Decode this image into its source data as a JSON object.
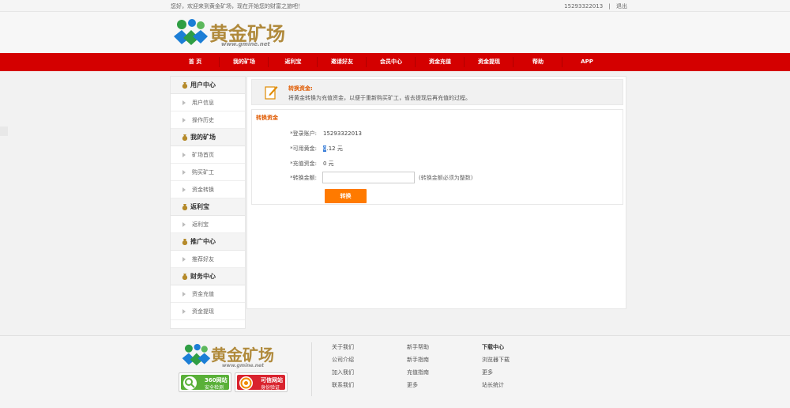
{
  "topbar": {
    "welcome": "您好，欢迎来到黄金矿场，现在开始您的财富之旅吧！",
    "account": "15293322013",
    "logout": "退出"
  },
  "brand": {
    "name": "黄金矿场",
    "url": "www.gmine.net"
  },
  "nav": {
    "items": [
      "首 页",
      "我的矿场",
      "返利宝",
      "邀请好友",
      "会员中心",
      "资金充值",
      "资金提现",
      "帮助",
      "APP"
    ]
  },
  "sidebar": {
    "groups": [
      {
        "title": "用户中心",
        "items": [
          "用户信息",
          "操作历史"
        ]
      },
      {
        "title": "我的矿场",
        "items": [
          "矿场首页",
          "购买矿工",
          "资金转换"
        ]
      },
      {
        "title": "返利宝",
        "items": [
          "返利宝"
        ]
      },
      {
        "title": "推广中心",
        "items": [
          "推荐好友"
        ]
      },
      {
        "title": "财务中心",
        "items": [
          "资金充值",
          "资金提现"
        ]
      }
    ]
  },
  "notice": {
    "title": "转换资金:",
    "text": "将黄金转换为充值资金，以便于重新购买矿工，省去提现后再充值的过程。"
  },
  "form": {
    "title": "转换资金",
    "account_label": "登录账户:",
    "account_value": "15293322013",
    "gold_label": "可用黄金:",
    "gold_value_sel": "0",
    "gold_value_rest": ".12 元",
    "recharge_label": "充值资金:",
    "recharge_value": "0 元",
    "amount_label": "转换金额:",
    "amount_value": "",
    "amount_hint": "(转换金额必须为整数)",
    "submit": "转换"
  },
  "footer": {
    "badges": [
      {
        "line1": "360网站",
        "line2": "安全检测"
      },
      {
        "line1": "可信网站",
        "line2": "身份验证"
      }
    ],
    "columns": [
      [
        "关于我们",
        "公司介绍",
        "加入我们",
        "联系我们"
      ],
      [
        "新手帮助",
        "新手指南",
        "充值指南",
        "更多"
      ],
      [
        "下载中心",
        "浏览器下载",
        "更多",
        "站长统计"
      ]
    ]
  },
  "colors": {
    "nav_red": "#d40000",
    "accent_orange": "#ff7a00",
    "brand_gold": "#b08a3c"
  }
}
